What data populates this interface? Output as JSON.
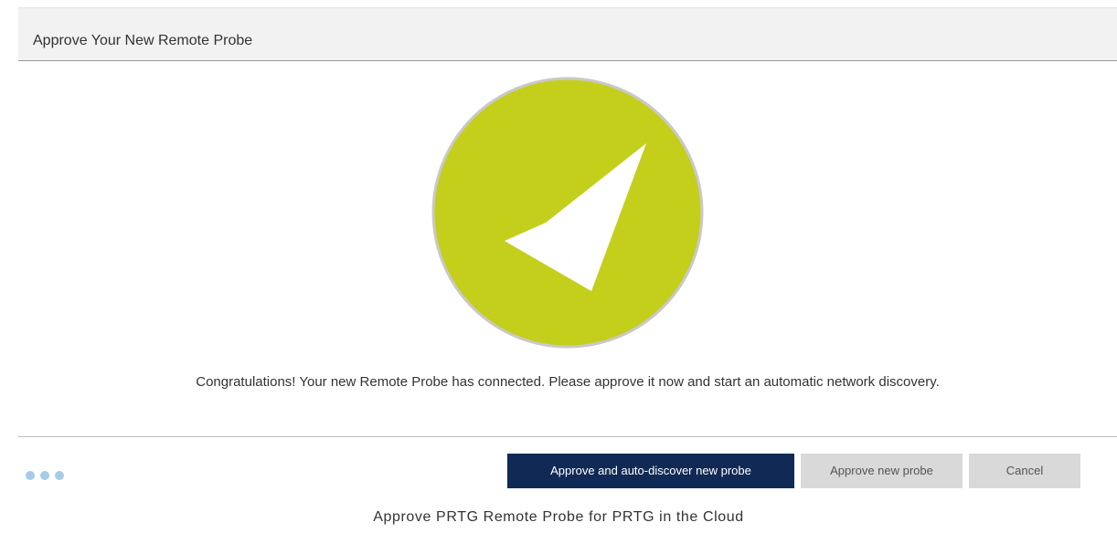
{
  "dialog": {
    "title": "Approve Your New Remote Probe",
    "message": "Congratulations! Your new Remote Probe has connected. Please approve it now and start an automatic network discovery.",
    "status_icon": "checkmark-icon",
    "status_color": "#c4cf1c",
    "loading_indicator": "dots-icon",
    "buttons": {
      "approve_discover_label": "Approve and auto-discover new probe",
      "approve_label": "Approve new probe",
      "cancel_label": "Cancel"
    }
  },
  "caption": "Approve PRTG Remote Probe for PRTG in the Cloud",
  "colors": {
    "primary_button": "#112a55",
    "secondary_button": "#d9d9d9",
    "dots": "#a6cbe8"
  }
}
